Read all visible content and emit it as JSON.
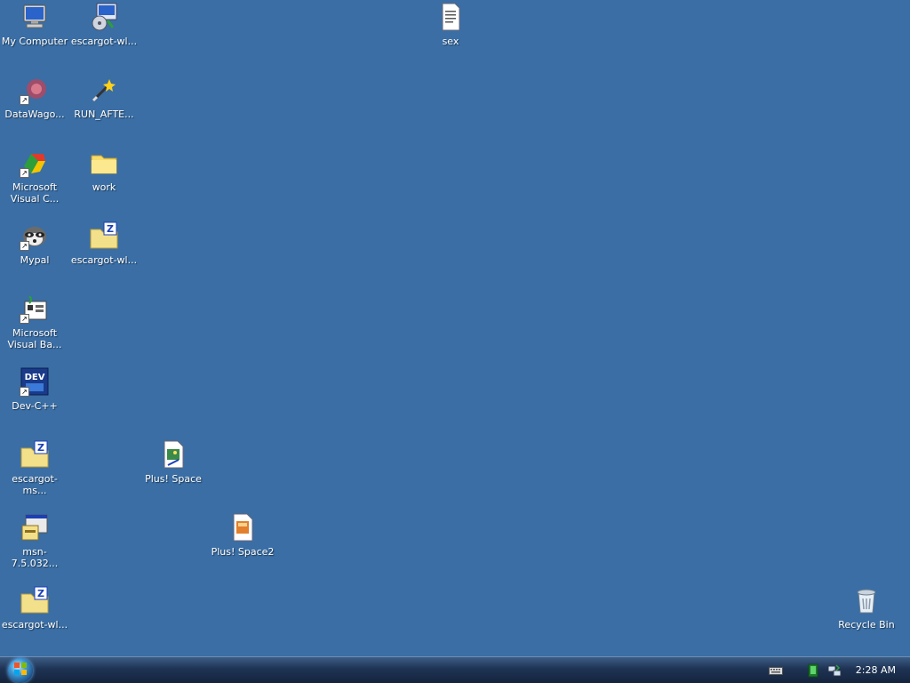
{
  "desktop": {
    "background": "#3a6ea5",
    "icons": {
      "my_computer": "My Computer",
      "escargot_wl_setup": "escargot-wl...",
      "sex_doc": "sex",
      "datawagon": "DataWago...",
      "run_after": "RUN_AFTE...",
      "ms_visual_c": "Microsoft\nVisual C...",
      "work_folder": "work",
      "mypal": "Mypal",
      "escargot_wl_zip1": "escargot-wl...",
      "ms_visual_basic": "Microsoft\nVisual Ba...",
      "dev_cpp": "Dev-C++",
      "escargot_ms_zip": "escargot-ms...",
      "plus_space": "Plus! Space",
      "msn_installer": "msn-7.5.032...",
      "plus_space2": "Plus! Space2",
      "escargot_wl_zip2": "escargot-wl...",
      "recycle_bin": "Recycle Bin"
    }
  },
  "taskbar": {
    "clock": "2:28 AM",
    "tray_icons": [
      "keyboard-icon",
      "network-icon",
      "network-connection-icon"
    ]
  },
  "colors": {
    "desktop": "#3a6ea5",
    "taskbar": "#1e3354"
  }
}
